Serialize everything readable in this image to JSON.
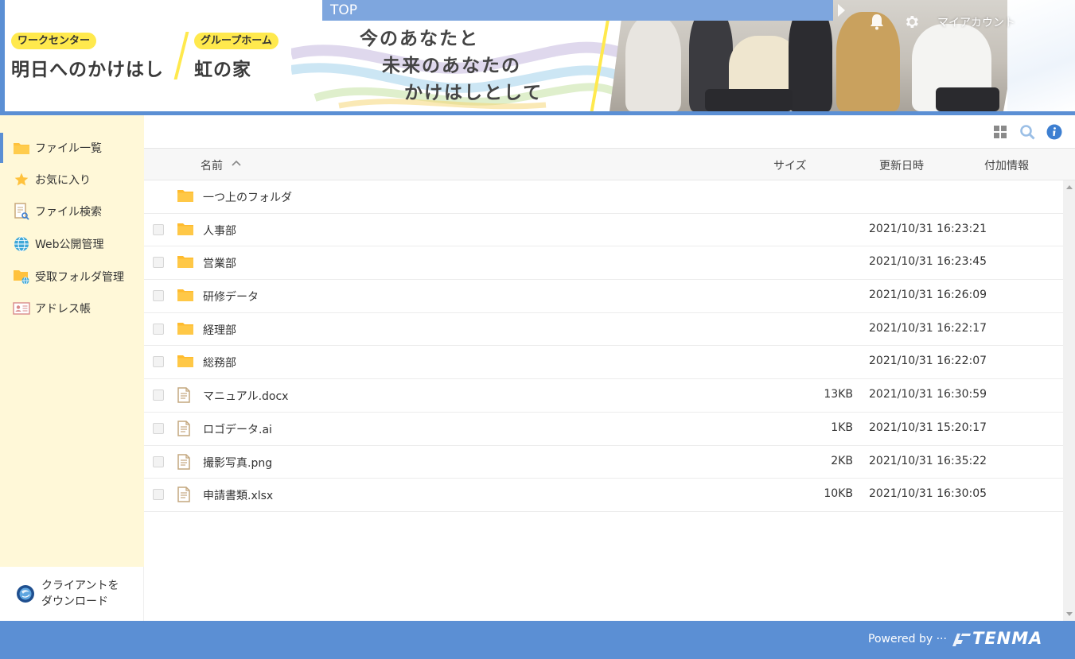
{
  "header": {
    "top_label": "TOP",
    "account_label": "マイアカウント",
    "brand_1": {
      "pill": "ワークセンター",
      "title": "明日へのかけはし"
    },
    "brand_2": {
      "pill": "グループホーム",
      "title": "虹の家"
    },
    "tagline": [
      "今のあなたと",
      "未来のあなたの",
      "かけはしとして"
    ]
  },
  "sidebar": {
    "items": [
      {
        "label": "ファイル一覧",
        "icon": "folder-icon",
        "active": true
      },
      {
        "label": "お気に入り",
        "icon": "star-icon"
      },
      {
        "label": "ファイル検索",
        "icon": "file-search-icon"
      },
      {
        "label": "Web公開管理",
        "icon": "globe-icon"
      },
      {
        "label": "受取フォルダ管理",
        "icon": "receive-folder-icon"
      },
      {
        "label": "アドレス帳",
        "icon": "address-book-icon"
      }
    ],
    "download": {
      "line1": "クライアントを",
      "line2": "ダウンロード",
      "icon": "client-download-icon"
    }
  },
  "columns": {
    "name": "名前",
    "size": "サイズ",
    "updated": "更新日時",
    "info": "付加情報"
  },
  "files": [
    {
      "type": "parent",
      "name": "一つ上のフォルダ",
      "size": "",
      "updated": ""
    },
    {
      "type": "folder",
      "name": "人事部",
      "size": "",
      "updated": "2021/10/31 16:23:21"
    },
    {
      "type": "folder",
      "name": "営業部",
      "size": "",
      "updated": "2021/10/31 16:23:45"
    },
    {
      "type": "folder",
      "name": "研修データ",
      "size": "",
      "updated": "2021/10/31 16:26:09"
    },
    {
      "type": "folder",
      "name": "経理部",
      "size": "",
      "updated": "2021/10/31 16:22:17"
    },
    {
      "type": "folder",
      "name": "総務部",
      "size": "",
      "updated": "2021/10/31 16:22:07"
    },
    {
      "type": "file",
      "name": "マニュアル.docx",
      "size": "13KB",
      "updated": "2021/10/31 16:30:59"
    },
    {
      "type": "file",
      "name": "ロゴデータ.ai",
      "size": "1KB",
      "updated": "2021/10/31 15:20:17"
    },
    {
      "type": "file",
      "name": "撮影写真.png",
      "size": "2KB",
      "updated": "2021/10/31 16:35:22"
    },
    {
      "type": "file",
      "name": "申請書類.xlsx",
      "size": "10KB",
      "updated": "2021/10/31 16:30:05"
    }
  ],
  "footer": {
    "powered_by": "Powered by ···",
    "brand": "TENMA"
  },
  "colors": {
    "accent": "#5b8fd4",
    "sidebar_bg": "#fff8d8",
    "folder": "#ffc23d",
    "brand_yellow": "#ffe94d"
  }
}
